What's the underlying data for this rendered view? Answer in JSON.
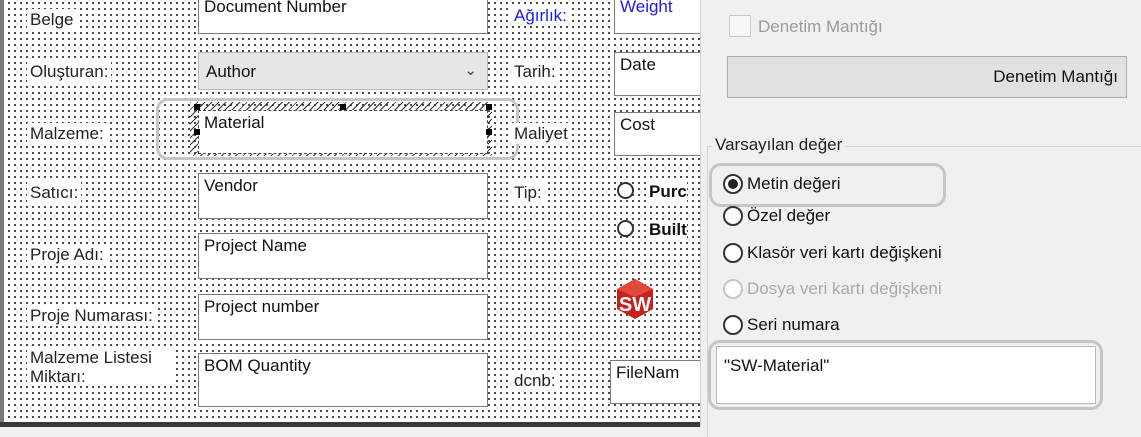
{
  "form": {
    "labels": {
      "belge": "Belge",
      "olusturan": "Oluşturan:",
      "malzeme": "Malzeme:",
      "satici": "Satıcı:",
      "proje_adi": "Proje Adı:",
      "proje_numarasi": "Proje Numarası:",
      "malzeme_listesi": "Malzeme Listesi Miktarı:",
      "agirlik": "Ağırlık:",
      "tarih": "Tarih:",
      "maliyet": "Maliyet",
      "tip": "Tip:",
      "dcnb": "dcnb:"
    },
    "fields": {
      "belge": "Document Number",
      "olusturan": "Author",
      "malzeme": "Material",
      "satici": "Vendor",
      "proje_adi": "Project Name",
      "proje_numarasi": "Project number",
      "malzeme_listesi": "BOM Quantity",
      "agirlik": "Weight",
      "tarih": "Date",
      "maliyet": "Cost",
      "dcnb": "FileNam"
    },
    "tip_options": [
      "Purc",
      "Built"
    ],
    "logo_text": "SW"
  },
  "panel": {
    "checkbox_label": "Denetim Mantığı",
    "button_label": "Denetim Mantığı",
    "group_title": "Varsayılan değer",
    "options": [
      {
        "label": "Metin değeri",
        "selected": true,
        "enabled": true
      },
      {
        "label": "Özel değer",
        "selected": false,
        "enabled": true
      },
      {
        "label": "Klasör veri kartı değişkeni",
        "selected": false,
        "enabled": true
      },
      {
        "label": "Dosya veri kartı değişkeni",
        "selected": false,
        "enabled": false
      },
      {
        "label": "Seri numara",
        "selected": false,
        "enabled": true
      }
    ],
    "value": "\"SW-Material\""
  },
  "colors": {
    "label_blue": "#1a1aee",
    "logo_red": "#c8201a",
    "highlight": "#c5c5c5"
  }
}
